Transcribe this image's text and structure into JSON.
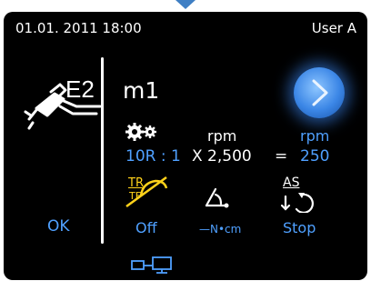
{
  "status": {
    "datetime": "01.01. 2011 18:00",
    "user": "User A"
  },
  "left": {
    "mode": "E2",
    "ok_label": "OK"
  },
  "program": {
    "name": "m1"
  },
  "ratio": {
    "value": "10R : 1"
  },
  "motor": {
    "unit": "rpm",
    "value": "X 2,500"
  },
  "output": {
    "equals": "=",
    "unit": "rpm",
    "value": "250"
  },
  "torque_reverse": {
    "tr": "TR",
    "tf": "TF",
    "state": "Off"
  },
  "torque": {
    "unit": "—N•cm"
  },
  "auto_stop": {
    "as": "AS",
    "state": "Stop"
  },
  "icons": {
    "handpiece": "handpiece-icon",
    "play": "play-icon",
    "gear": "gear-ratio-icon",
    "torque_reverse": "torque-reverse-disabled-icon",
    "torque": "torque-angle-icon",
    "auto_stop": "auto-stop-icon",
    "network": "network-connection-icon"
  },
  "colors": {
    "accent": "#4fa0ff",
    "warning": "#ffd21a",
    "background": "#000000",
    "play": "#3b86e6"
  }
}
